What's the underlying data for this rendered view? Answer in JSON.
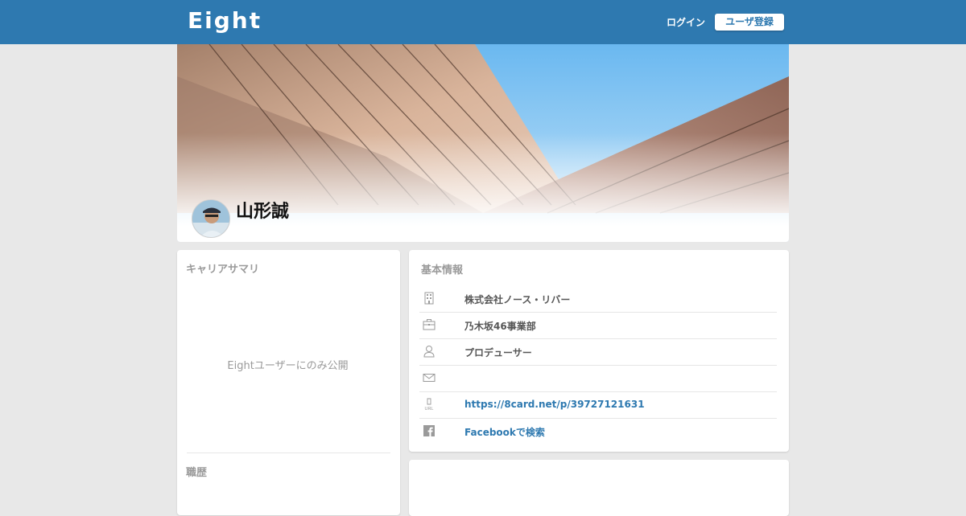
{
  "header": {
    "logo": "Eight",
    "login_label": "ログイン",
    "register_label": "ユーザ登録",
    "brand_color": "#2e79b0"
  },
  "profile": {
    "name": "山形誠"
  },
  "career": {
    "title": "キャリアサマリ",
    "restricted_text": "Eightユーザーにのみ公開",
    "history_title": "職歴"
  },
  "basic_info": {
    "title": "基本情報",
    "rows": [
      {
        "icon": "building-icon",
        "text": "株式会社ノース・リバー"
      },
      {
        "icon": "briefcase-icon",
        "text": "乃木坂46事業部"
      },
      {
        "icon": "person-icon",
        "text": "プロデューサー"
      },
      {
        "icon": "mail-icon",
        "text": ""
      },
      {
        "icon": "url-icon",
        "text": "https://8card.net/p/39727121631"
      },
      {
        "icon": "facebook-icon",
        "text": "Facebookで検索"
      }
    ]
  }
}
